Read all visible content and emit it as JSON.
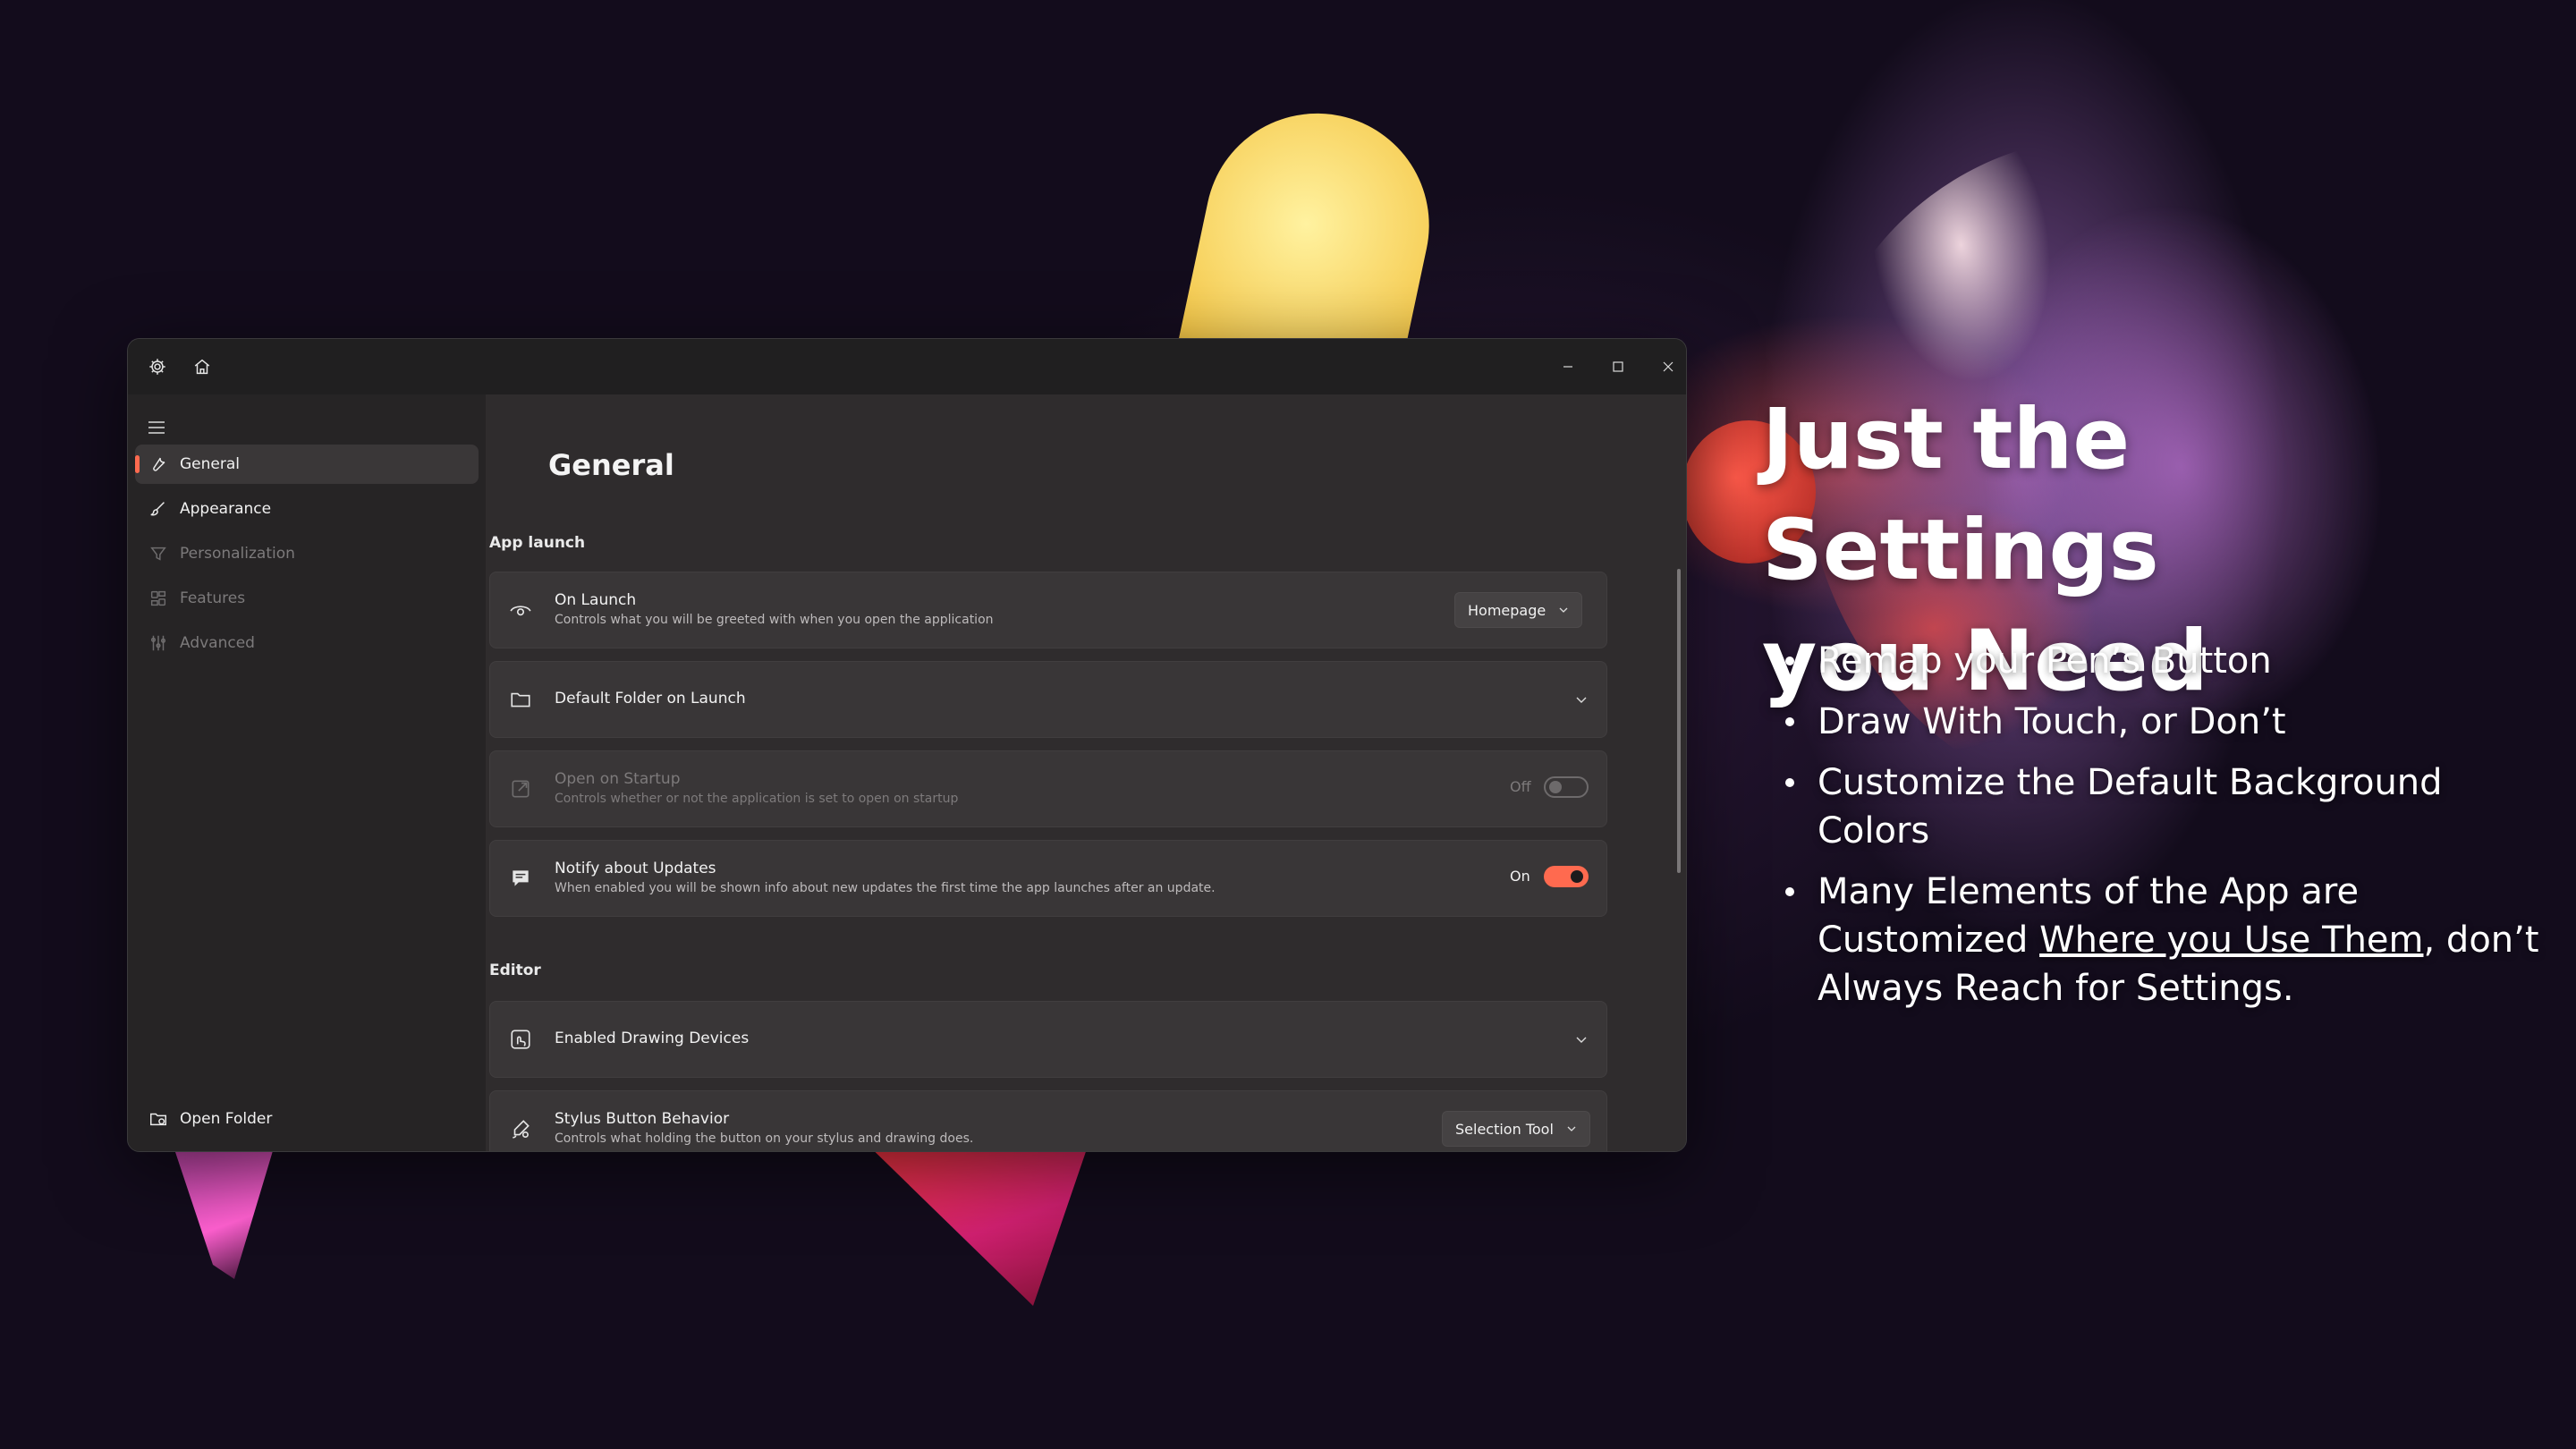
{
  "window": {
    "nav": [
      {
        "label": "General",
        "active": true,
        "disabled": false,
        "icon": "wrench-icon"
      },
      {
        "label": "Appearance",
        "active": false,
        "disabled": false,
        "icon": "brush-icon"
      },
      {
        "label": "Personalization",
        "active": false,
        "disabled": true,
        "icon": "funnel-icon"
      },
      {
        "label": "Features",
        "active": false,
        "disabled": true,
        "icon": "features-icon"
      },
      {
        "label": "Advanced",
        "active": false,
        "disabled": true,
        "icon": "advanced-icon"
      }
    ],
    "open_folder_label": "Open Folder",
    "page_title": "General",
    "sections": {
      "app_launch": "App launch",
      "editor": "Editor"
    },
    "cards": {
      "on_launch": {
        "title": "On Launch",
        "subtitle": "Controls what you will be greeted with when you open the application",
        "value": "Homepage"
      },
      "default_folder": {
        "title": "Default Folder on Launch"
      },
      "open_on_startup": {
        "title": "Open on Startup",
        "subtitle": "Controls whether or not the application is set to open on startup",
        "state_label": "Off"
      },
      "notify_updates": {
        "title": "Notify about Updates",
        "subtitle": "When enabled you will be shown info about new updates the first time the app launches after an update.",
        "state_label": "On"
      },
      "drawing_devices": {
        "title": "Enabled Drawing Devices"
      },
      "stylus_button": {
        "title": "Stylus Button Behavior",
        "subtitle": "Controls what holding the button on your stylus and drawing does.",
        "value": "Selection Tool"
      }
    }
  },
  "marketing": {
    "headline_line1": "Just the Settings",
    "headline_line2": "you Need",
    "bullets": {
      "b1": "Remap your Pen’s Button",
      "b2": "Draw With Touch, or Don’t",
      "b3": "Customize the Default Background Colors",
      "b4_pre": "Many Elements of the App are Customized ",
      "b4_link": "Where you Use Them",
      "b4_post": ", don’t Always Reach for Settings."
    }
  },
  "colors": {
    "accent": "#ff6a4f",
    "window_bg": "#2c2a2b",
    "card_bg": "#393637"
  }
}
